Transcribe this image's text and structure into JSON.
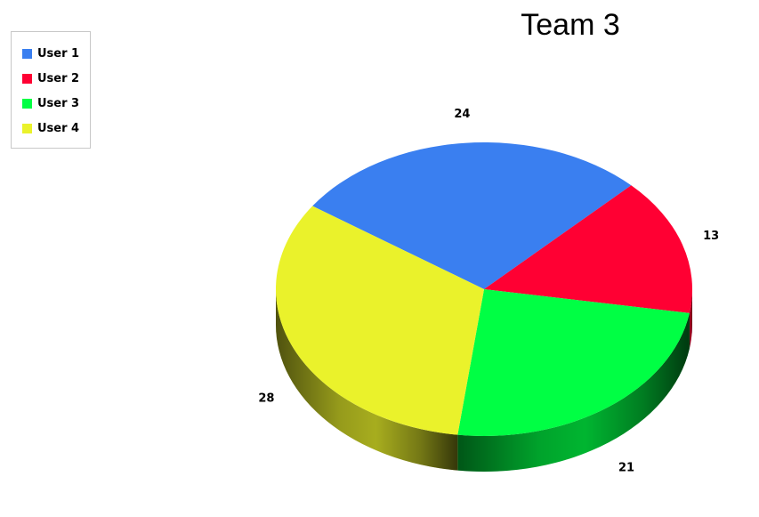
{
  "chart_data": {
    "type": "pie",
    "title": "Team 3",
    "categories": [
      "User 1",
      "User 2",
      "User 3",
      "User 4"
    ],
    "values": [
      24,
      13,
      21,
      28
    ],
    "colors": [
      "#3a7ff0",
      "#ff0033",
      "#00ff44",
      "#eaf22b"
    ],
    "legend_position": "top-left",
    "three_d": true
  }
}
